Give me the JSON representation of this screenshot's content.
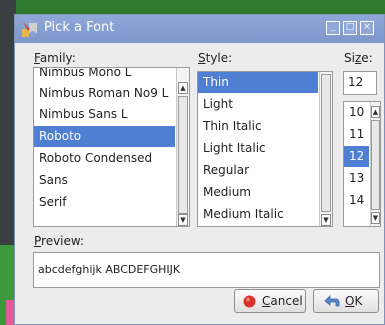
{
  "window": {
    "title": "Pick a Font",
    "controls": [
      "_",
      "□",
      "×"
    ]
  },
  "family": {
    "label_u": "F",
    "label_rest": "amily:",
    "items": [
      "Nimbus Mono L",
      "Nimbus Roman No9 L",
      "Nimbus Sans L",
      "Roboto",
      "Roboto Condensed",
      "Sans",
      "Serif"
    ],
    "selected": "Roboto"
  },
  "style": {
    "label_u": "S",
    "label_rest": "tyle:",
    "items": [
      "Thin",
      "Light",
      "Thin Italic",
      "Light Italic",
      "Regular",
      "Medium",
      "Medium Italic"
    ],
    "selected": "Thin"
  },
  "size": {
    "label_pre": "Si",
    "label_u": "z",
    "label_rest": "e:",
    "value": "12",
    "items": [
      "10",
      "11",
      "12",
      "13",
      "14"
    ],
    "selected": "12"
  },
  "preview": {
    "label_u": "P",
    "label_rest": "review:",
    "text": "abcdefghijk ABCDEFGHIJK"
  },
  "buttons": {
    "cancel_u": "C",
    "cancel_rest": "ancel",
    "ok_u": "O",
    "ok_rest": "K"
  },
  "colors": {
    "selection": "#4e7fd2",
    "titlebar": "#7e97cc",
    "cancel_icon": "#d9322b",
    "ok_icon": "#5a86c9"
  }
}
